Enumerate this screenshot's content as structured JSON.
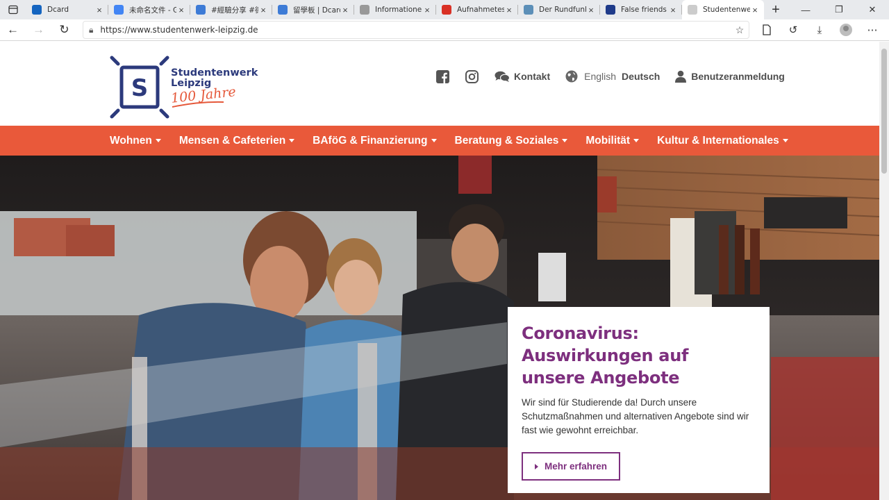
{
  "browser": {
    "tabs": [
      {
        "title": "Dcard",
        "favicon": "dcard-icon",
        "color": "#1565c0"
      },
      {
        "title": "未命名文件 - G",
        "favicon": "docs-icon",
        "color": "#4285f4"
      },
      {
        "title": "#經驗分享 #德",
        "favicon": "dcard-icon",
        "color": "#3d7bd6"
      },
      {
        "title": "留學板 | Dcard",
        "favicon": "dcard-icon",
        "color": "#3d7bd6"
      },
      {
        "title": "Informationen",
        "favicon": "globe-icon",
        "color": "#999999"
      },
      {
        "title": "Aufnahmetest",
        "favicon": "gmail-icon",
        "color": "#d93025"
      },
      {
        "title": "Der Rundfunk",
        "favicon": "arrow-icon",
        "color": "#5c8fb8"
      },
      {
        "title": "False friends",
        "favicon": "uk-flag-icon",
        "color": "#1f3b8a"
      },
      {
        "title": "Studentenwer",
        "favicon": "page-icon",
        "color": "#cccccc"
      }
    ],
    "url": "https://www.studentenwerk-leipzig.de"
  },
  "header": {
    "logo_line1": "Studentenwerk",
    "logo_line2": "Leipzig",
    "logo_anniversary": "100 Jahre",
    "contact": "Kontakt",
    "lang_en": "English",
    "lang_de": "Deutsch",
    "login": "Benutzeranmeldung"
  },
  "nav": {
    "items": [
      "Wohnen",
      "Mensen & Cafeterien",
      "BAföG & Finanzierung",
      "Beratung & Soziales",
      "Mobilität",
      "Kultur & Internationales"
    ]
  },
  "hero": {
    "title": "Coronavirus: Auswirkungen auf unsere Angebote",
    "text": "Wir sind für Studierende da! Durch unsere Schutzmaßnahmen und alternativen Angebote sind wir fast wie gewohnt erreichbar.",
    "button": "Mehr erfahren"
  },
  "colors": {
    "accent": "#e9593a",
    "brand": "#2c3a7c",
    "card_title": "#7d2f7e"
  }
}
